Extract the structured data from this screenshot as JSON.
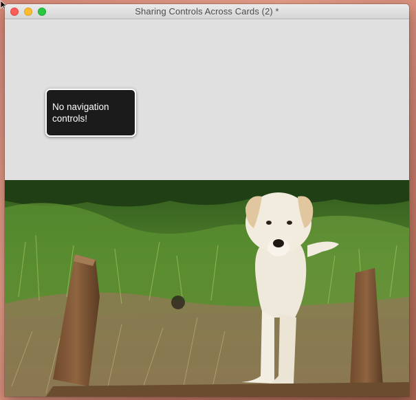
{
  "window": {
    "title": "Sharing Controls Across Cards (2) *"
  },
  "callout": {
    "text": "No navigation controls!"
  },
  "photo": {
    "subject": "puppy-photo"
  },
  "colors": {
    "close": "#fc5f57",
    "minimize": "#fdbc2e",
    "zoom": "#28c840",
    "callout_bg": "#1b1b1b",
    "content_bg": "#e0e0e0"
  }
}
